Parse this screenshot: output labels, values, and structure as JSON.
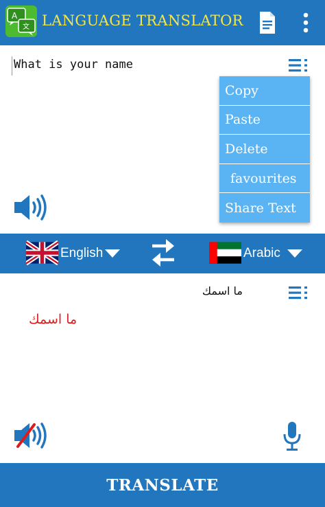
{
  "app": {
    "title": "LANGUAGE TRANSLATOR"
  },
  "input": {
    "text": "What is your name"
  },
  "context_menu": {
    "items": [
      {
        "label": "Copy"
      },
      {
        "label": "Paste"
      },
      {
        "label": "Delete"
      },
      {
        "label": "favourites"
      },
      {
        "label": "Share Text"
      }
    ]
  },
  "languages": {
    "from": {
      "label": "English",
      "flag_icon": "uk-flag-icon"
    },
    "to": {
      "label": "Arabic",
      "flag_icon": "uae-flag-icon"
    }
  },
  "output": {
    "text_top": "ما اسمك",
    "text_translated": "ما اسمك"
  },
  "translate_button": {
    "label": "TRANSLATE"
  },
  "colors": {
    "primary": "#2176bd",
    "title": "#f2e64b",
    "menu_bg": "#5ab3f2",
    "translated_text": "#e01b1b"
  },
  "icons": [
    "app-logo-icon",
    "document-icon",
    "more-vert-icon",
    "lines-menu-icon",
    "speaker-icon",
    "swap-icon",
    "speaker-muted-icon",
    "microphone-icon"
  ]
}
